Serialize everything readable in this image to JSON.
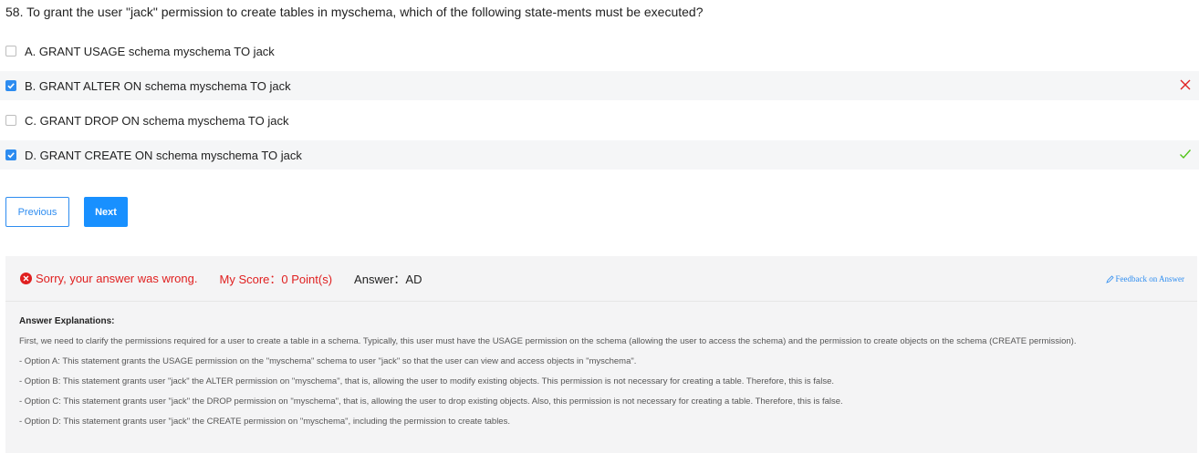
{
  "question": {
    "text": "58. To grant the user \"jack\" permission to create tables in myschema, which of the following state-ments must be executed?"
  },
  "options": [
    {
      "label": "A. GRANT USAGE schema myschema TO jack",
      "checked": false,
      "mark": ""
    },
    {
      "label": "B. GRANT ALTER ON schema myschema TO jack",
      "checked": true,
      "mark": "wrong"
    },
    {
      "label": "C. GRANT DROP ON schema myschema TO jack",
      "checked": false,
      "mark": ""
    },
    {
      "label": "D. GRANT CREATE ON schema myschema TO jack",
      "checked": true,
      "mark": "correct"
    }
  ],
  "buttons": {
    "previous": "Previous",
    "next": "Next"
  },
  "result": {
    "wrong_text": "Sorry, your answer was wrong.",
    "score_text": "My Score：0 Point(s)",
    "answer_text": "Answer：AD",
    "feedback_text": "Feedback on Answer"
  },
  "explanation": {
    "title": "Answer Explanations:",
    "lines": [
      "First, we need to clarify the permissions required for a user to create a table in a schema. Typically, this user must have the USAGE permission on the schema (allowing the user to access the schema) and the permission to create objects on the schema (CREATE permission).",
      "- Option A: This statement grants the USAGE permission on the \"myschema\" schema to user \"jack\" so that the user can view and access objects in \"myschema\".",
      "- Option B: This statement grants user \"jack\" the ALTER permission on \"myschema\", that is, allowing the user to modify existing objects. This permission is not necessary for creating a table. Therefore, this is false.",
      "- Option C: This statement grants user \"jack\" the DROP permission on \"myschema\", that is, allowing the user to drop existing objects. Also, this permission is not necessary for creating a table. Therefore, this is false.",
      "- Option D: This statement grants user \"jack\" the CREATE permission on \"myschema\", including the permission to create tables."
    ]
  },
  "colors": {
    "accent": "#1890ff",
    "error": "#e02020",
    "success": "#52c41a"
  }
}
